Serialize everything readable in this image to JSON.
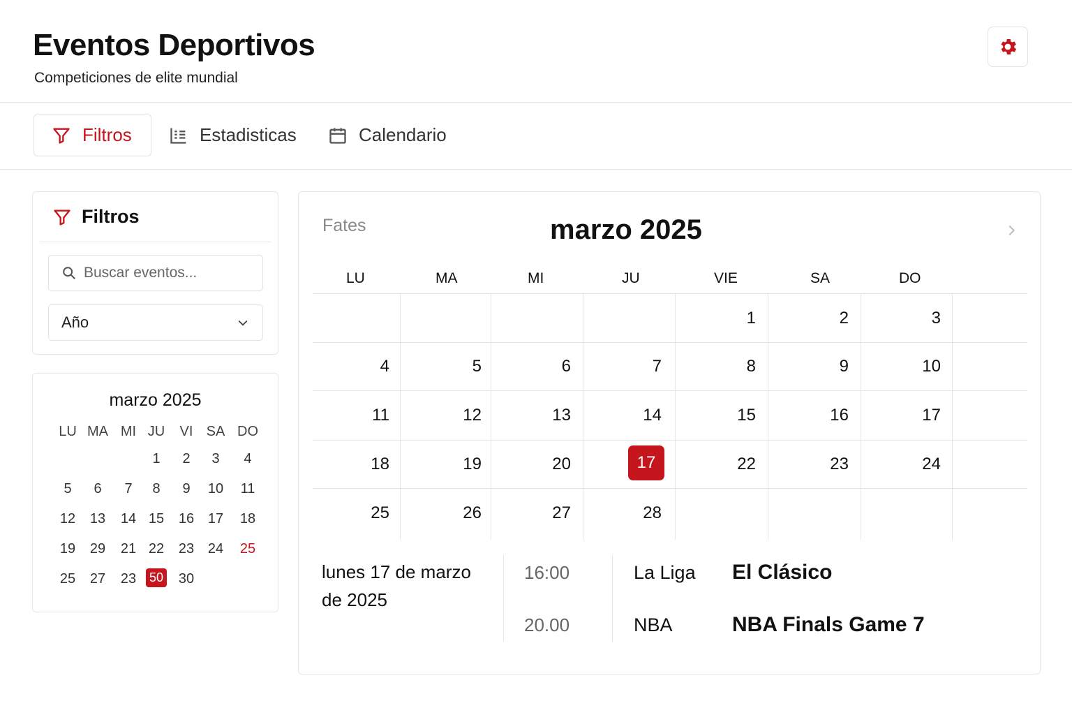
{
  "header": {
    "title": "Eventos Deportivos",
    "subtitle": "Competiciones de elite mundial",
    "settings_icon": "gear-icon"
  },
  "tabs": [
    {
      "label": "Filtros",
      "icon": "filter-icon",
      "active": true
    },
    {
      "label": "Estadisticas",
      "icon": "stats-list-icon",
      "active": false
    },
    {
      "label": "Calendario",
      "icon": "calendar-icon",
      "active": false
    }
  ],
  "filters": {
    "title": "Filtros",
    "search_placeholder": "Buscar eventos...",
    "year_select": "Año"
  },
  "mini_calendar": {
    "title": "marzo 2025",
    "day_headers": [
      "LU",
      "MA",
      "MI",
      "JU",
      "VI",
      "SA",
      "DO"
    ],
    "weeks": [
      [
        "",
        "",
        "",
        "1",
        "2",
        "3",
        "4"
      ],
      [
        "5",
        "6",
        "7",
        "8",
        "9",
        "10",
        "11"
      ],
      [
        "12",
        "13",
        "14",
        "15",
        "16",
        "17",
        "18"
      ],
      [
        "19",
        "29",
        "21",
        "22",
        "23",
        "24",
        "25"
      ],
      [
        "25",
        "27",
        "23",
        "50",
        "30",
        "",
        ""
      ]
    ],
    "highlighted_red": "25",
    "selected": "50"
  },
  "main_calendar": {
    "label": "Fates",
    "title": "marzo 2025",
    "day_headers": [
      "LU",
      "MA",
      "MI",
      "JU",
      "VIE",
      "SA",
      "DO"
    ],
    "weeks": [
      [
        "",
        "",
        "",
        "",
        "1",
        "2",
        "3"
      ],
      [
        "4",
        "5",
        "6",
        "7",
        "8",
        "9",
        "10"
      ],
      [
        "11",
        "12",
        "13",
        "14",
        "15",
        "16",
        "17"
      ],
      [
        "18",
        "19",
        "20",
        "17",
        "22",
        "23",
        "24"
      ],
      [
        "25",
        "26",
        "27",
        "28",
        "",
        "",
        ""
      ]
    ],
    "selected": "17",
    "accent": "#c4161c"
  },
  "events": {
    "date_label": "lunes 17 de marzo de 2025",
    "items": [
      {
        "time": "16:00",
        "league": "La Liga",
        "name": "El Clásico"
      },
      {
        "time": "20.00",
        "league": "NBA",
        "name": "NBA Finals Game 7"
      }
    ]
  }
}
